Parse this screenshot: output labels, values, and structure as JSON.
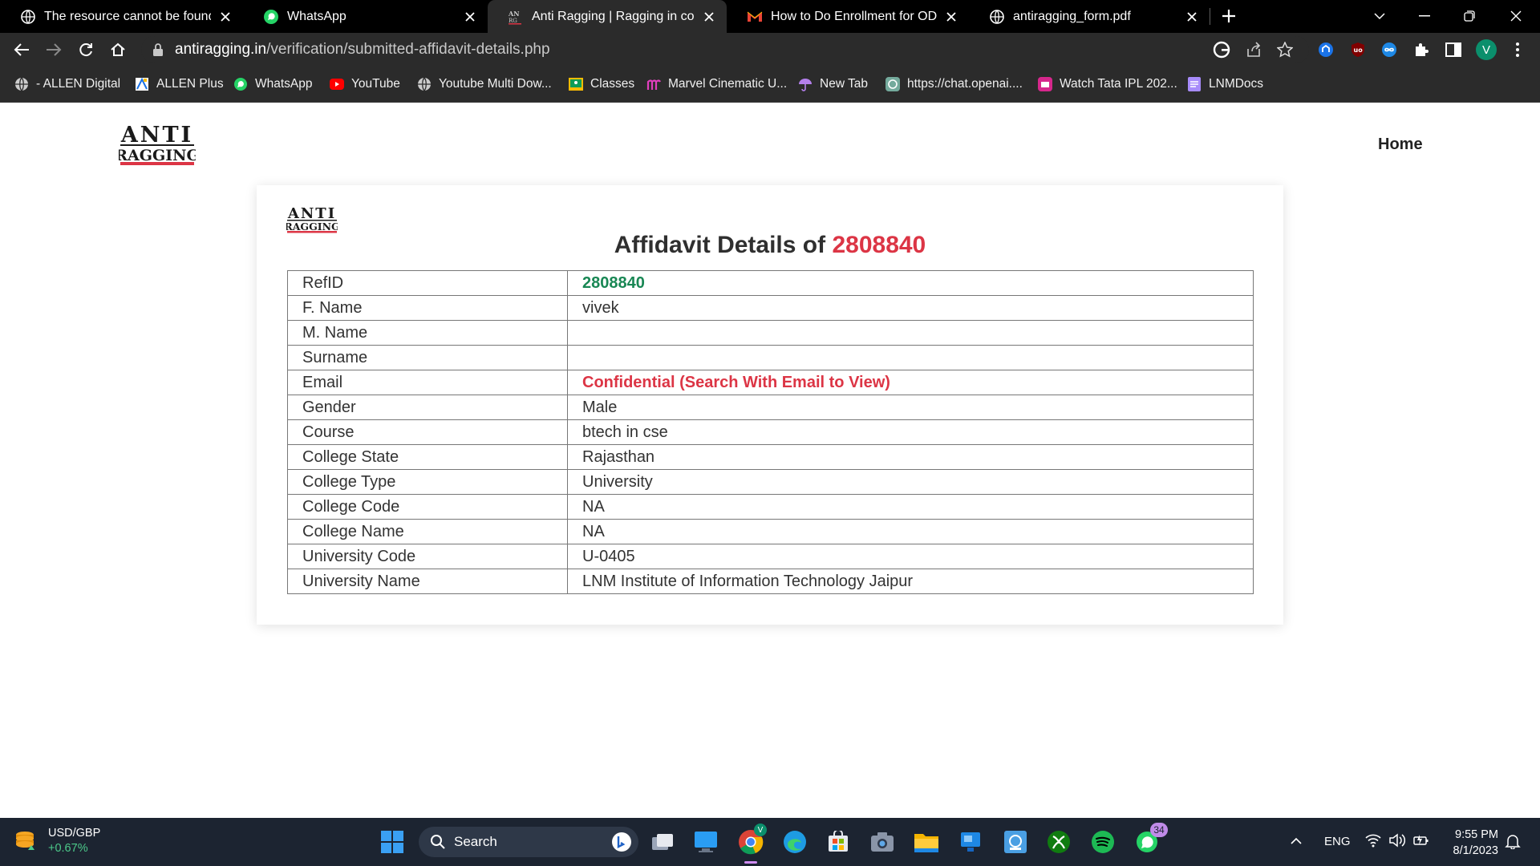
{
  "browser": {
    "tabs": [
      {
        "title": "The resource cannot be found.",
        "icon": "globe-icon",
        "active": false
      },
      {
        "title": "WhatsApp",
        "icon": "whatsapp-icon",
        "active": false
      },
      {
        "title": "Anti Ragging | Ragging in college",
        "icon": "antiragging-icon",
        "active": true
      },
      {
        "title": "How to Do Enrollment for ODD S",
        "icon": "gmail-icon",
        "active": false
      },
      {
        "title": "antiragging_form.pdf",
        "icon": "globe-icon",
        "active": false
      }
    ],
    "address_bar": {
      "host": "antiragging.in",
      "path": "/verification/submitted-affidavit-details.php"
    },
    "profile_initial": "V",
    "bookmarks": [
      {
        "label": "- ALLEN Digital",
        "icon": "globe-icon"
      },
      {
        "label": "ALLEN Plus",
        "icon": "allen-plus-icon"
      },
      {
        "label": "WhatsApp",
        "icon": "whatsapp-icon"
      },
      {
        "label": "YouTube",
        "icon": "youtube-icon"
      },
      {
        "label": "Youtube Multi Dow...",
        "icon": "globe-icon"
      },
      {
        "label": "Classes",
        "icon": "classroom-icon"
      },
      {
        "label": "Marvel Cinematic U...",
        "icon": "marvel-icon"
      },
      {
        "label": "New Tab",
        "icon": "umbrella-icon"
      },
      {
        "label": "https://chat.openai....",
        "icon": "openai-icon"
      },
      {
        "label": "Watch Tata IPL 202...",
        "icon": "jiocinema-icon"
      },
      {
        "label": "LNMDocs",
        "icon": "docs-icon"
      }
    ]
  },
  "site": {
    "logo_text_top": "ANTI",
    "logo_text_bottom": "RAGGING",
    "nav_home": "Home"
  },
  "affidavit": {
    "title_prefix": "Affidavit Details of",
    "ref_no": "2808840",
    "rows": [
      {
        "label": "RefID",
        "value": "2808840",
        "style": "green"
      },
      {
        "label": "F. Name",
        "value": "vivek",
        "style": ""
      },
      {
        "label": "M. Name",
        "value": "",
        "style": ""
      },
      {
        "label": "Surname",
        "value": "",
        "style": ""
      },
      {
        "label": "Email",
        "value": "Confidential (Search With Email to View)",
        "style": "red"
      },
      {
        "label": "Gender",
        "value": "Male",
        "style": ""
      },
      {
        "label": "Course",
        "value": "btech in cse",
        "style": ""
      },
      {
        "label": "College State",
        "value": "Rajasthan",
        "style": ""
      },
      {
        "label": "College Type",
        "value": "University",
        "style": ""
      },
      {
        "label": "College Code",
        "value": "NA",
        "style": ""
      },
      {
        "label": "College Name",
        "value": "NA",
        "style": ""
      },
      {
        "label": "University Code",
        "value": "U-0405",
        "style": ""
      },
      {
        "label": "University Name",
        "value": "LNM Institute of Information Technology Jaipur",
        "style": ""
      }
    ]
  },
  "taskbar": {
    "stock_symbol": "USD/GBP",
    "stock_change": "+0.67%",
    "search_label": "Search",
    "whatsapp_badge": "34",
    "chrome_badge": "V",
    "language": "ENG",
    "time": "9:55 PM",
    "date": "8/1/2023"
  },
  "colors": {
    "accent_red": "#dc3545",
    "accent_green": "#198754",
    "chrome_dark": "#2b2b2b",
    "taskbar": "#1c2431"
  }
}
